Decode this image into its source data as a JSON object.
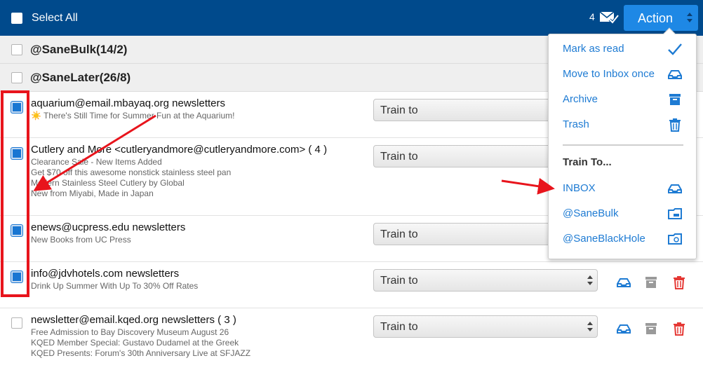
{
  "toolbar": {
    "select_all_label": "Select All",
    "count": "4",
    "mail_icon": "mail-check-icon",
    "action_label": "Action"
  },
  "groups": [
    {
      "name": "@SaneBulk(14/2)"
    },
    {
      "name": "@SaneLater(26/8)"
    }
  ],
  "messages": [
    {
      "sender": "aquarium@email.mbayaq.org newsletters",
      "subjects": [
        "☀️ There's Still Time for Summer Fun at the Aquarium!"
      ],
      "checked": true,
      "train_label": "Train to"
    },
    {
      "sender": "Cutlery and More <cutleryandmore@cutleryandmore.com> ( 4 )",
      "subjects": [
        "Clearance Sale - New Items Added",
        "Get $70 off this awesome nonstick stainless steel pan",
        "Modern Stainless Steel Cutlery by Global",
        "New from Miyabi, Made in Japan"
      ],
      "checked": true,
      "train_label": "Train to"
    },
    {
      "sender": "enews@ucpress.edu newsletters",
      "subjects": [
        "New Books from UC Press"
      ],
      "checked": true,
      "train_label": "Train to"
    },
    {
      "sender": "info@jdvhotels.com newsletters",
      "subjects": [
        "Drink Up Summer With Up To 30% Off Rates"
      ],
      "checked": true,
      "train_label": "Train to"
    },
    {
      "sender": "newsletter@email.kqed.org newsletters ( 3 )",
      "subjects": [
        "Free Admission to Bay Discovery Museum August 26",
        "KQED Member Special: Gustavo Dudamel at the Greek",
        "KQED Presents: Forum's 30th Anniversary Live at SFJAZZ"
      ],
      "checked": false,
      "train_label": "Train to"
    }
  ],
  "row_icons": [
    "inbox-tray-icon",
    "archive-box-icon",
    "trash-icon"
  ],
  "menu": {
    "actions": [
      {
        "label": "Mark as read",
        "icon": "checkmark-icon"
      },
      {
        "label": "Move to Inbox once",
        "icon": "inbox-tray-icon"
      },
      {
        "label": "Archive",
        "icon": "archive-box-icon"
      },
      {
        "label": "Trash",
        "icon": "trash-icon"
      }
    ],
    "train_heading": "Train To...",
    "train_targets": [
      {
        "label": "INBOX",
        "icon": "inbox-tray-icon"
      },
      {
        "label": "@SaneBulk",
        "icon": "bulk-folder-icon"
      },
      {
        "label": "@SaneBlackHole",
        "icon": "blackhole-folder-icon"
      }
    ]
  },
  "colors": {
    "topbar": "#004a8c",
    "accent": "#1e88e5",
    "link": "#1e7bd3",
    "annotation": "#e8141c",
    "trash_red": "#e53935"
  }
}
